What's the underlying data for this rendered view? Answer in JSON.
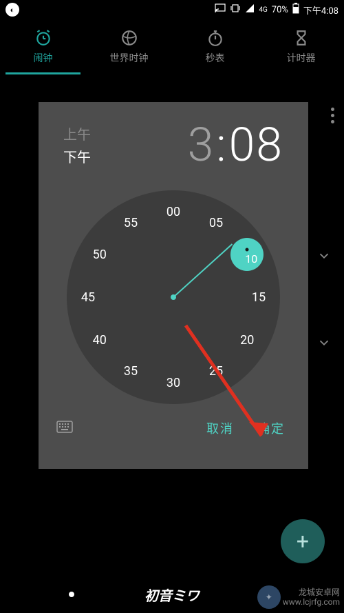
{
  "status_bar": {
    "battery_percent": "70%",
    "time": "下午4:08",
    "network_label": "4G"
  },
  "tabs": [
    {
      "label": "闹钟",
      "icon": "alarm"
    },
    {
      "label": "世界时钟",
      "icon": "globe"
    },
    {
      "label": "秒表",
      "icon": "stopwatch"
    },
    {
      "label": "计时器",
      "icon": "hourglass"
    }
  ],
  "time_picker": {
    "am_label": "上午",
    "pm_label": "下午",
    "selected_period": "下午",
    "hour": "3",
    "minute": "08",
    "selected_minute_value": "08",
    "clock_numbers": [
      "00",
      "05",
      "10",
      "15",
      "20",
      "25",
      "30",
      "35",
      "40",
      "45",
      "50",
      "55"
    ],
    "cancel_label": "取消",
    "confirm_label": "确定"
  },
  "fab": {
    "symbol": "+"
  },
  "nav": {
    "center_text": "初音ミワ"
  },
  "watermark": {
    "line1": "龙城安卓网",
    "line2": "www.lcjrfg.com"
  }
}
